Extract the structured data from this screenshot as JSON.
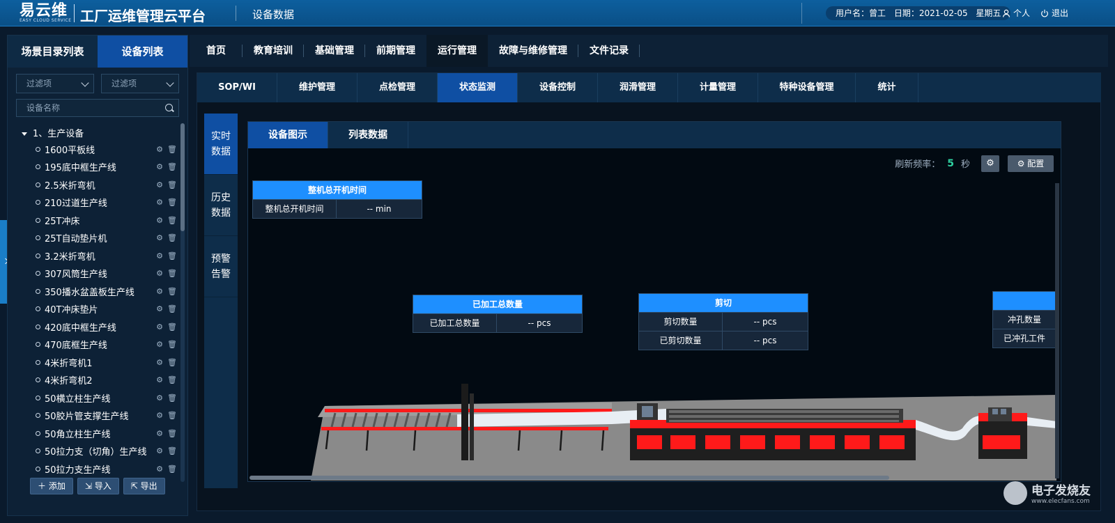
{
  "header": {
    "logo_text": "易云维",
    "logo_sub": "EASY CLOUD SERVICE",
    "app_title": "工厂运维管理云平台",
    "page_title": "设备数据",
    "user_label": "用户名：曾工",
    "date_label": "日期：2021-02-05",
    "weekday": "星期五",
    "profile_label": "个人",
    "logout_label": "退出"
  },
  "left_panel": {
    "tabs": [
      "场景目录列表",
      "设备列表"
    ],
    "active_tab": 1,
    "filter1_placeholder": "过滤项",
    "filter2_placeholder": "过滤项",
    "search_placeholder": "设备名称",
    "tree_root": "1、生产设备",
    "items": [
      "1600平板线",
      "195底中框生产线",
      "2.5米折弯机",
      "210过道生产线",
      "25T冲床",
      "25T自动垫片机",
      "3.2米折弯机",
      "307风筒生产线",
      "350播水盆盖板生产线",
      "40T冲床垫片",
      "420底中框生产线",
      "470底框生产线",
      "4米折弯机1",
      "4米折弯机2",
      "50横立柱生产线",
      "50胶片管支撑生产线",
      "50角立柱生产线",
      "50拉力支（切角）生产线",
      "50拉力支生产线"
    ],
    "buttons": {
      "add": "添加",
      "import": "导入",
      "export": "导出"
    }
  },
  "top_nav": {
    "items": [
      "首页",
      "教育培训",
      "基础管理",
      "前期管理",
      "运行管理",
      "故障与维修管理",
      "文件记录"
    ],
    "active": 4
  },
  "sub_nav": {
    "items": [
      "SOP/WI",
      "维护管理",
      "点检管理",
      "状态监测",
      "设备控制",
      "润滑管理",
      "计量管理",
      "特种设备管理",
      "统计"
    ],
    "active": 3
  },
  "vertical_tabs": {
    "items": [
      [
        "实时",
        "数据"
      ],
      [
        "历史",
        "数据"
      ],
      [
        "预警",
        "告警"
      ]
    ],
    "active": 0
  },
  "panel": {
    "tabs": [
      "设备图示",
      "列表数据"
    ],
    "active": 0,
    "refresh_label": "刷新频率：",
    "refresh_value": "5",
    "refresh_unit": "秒",
    "config_label": "配置"
  },
  "cards": {
    "runtime": {
      "title": "整机总开机时间",
      "rows": [
        {
          "k": "整机总开机时间",
          "v": "-- min"
        }
      ]
    },
    "processed": {
      "title": "已加工总数量",
      "rows": [
        {
          "k": "已加工总数量",
          "v": "-- pcs"
        }
      ]
    },
    "shear": {
      "title": "剪切",
      "rows": [
        {
          "k": "剪切数量",
          "v": "-- pcs"
        },
        {
          "k": "已剪切数量",
          "v": "-- pcs"
        }
      ]
    },
    "punch": {
      "title": "",
      "rows": [
        {
          "k": "冲孔数量",
          "v": ""
        },
        {
          "k": "已冲孔工件",
          "v": ""
        }
      ]
    }
  },
  "watermark": {
    "text": "电子发烧友",
    "sub": "www.elecfans.com"
  },
  "colors": {
    "accent": "#0f4fa3",
    "header": "#0a4f86",
    "card_head": "#1e8fff",
    "machine_red": "#ff1a1a",
    "refresh_value": "#2fd0a0"
  }
}
